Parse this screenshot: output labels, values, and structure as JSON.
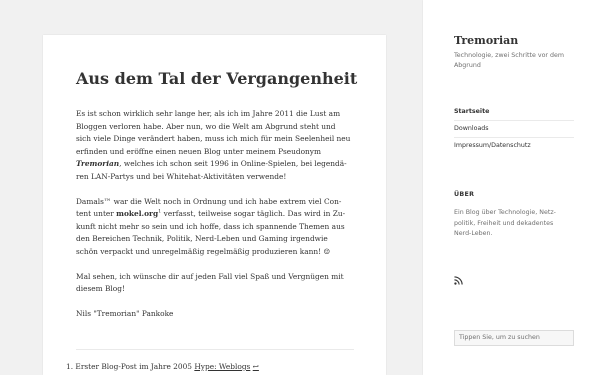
{
  "site": {
    "title": "Tremorian",
    "description": "Technologie, zwei Schritte vor dem Abgrund"
  },
  "nav": {
    "items": [
      {
        "label": "Startseite",
        "active": true
      },
      {
        "label": "Downloads",
        "active": false
      },
      {
        "label": "Impressum/Datenschutz",
        "active": false
      }
    ]
  },
  "widget": {
    "title": "ÜBER",
    "text": "Ein Blog über Technologie, Netz­politik, Freiheit und dekadentes Nerd-Leben."
  },
  "search": {
    "placeholder": "Tippen Sie, um zu suchen"
  },
  "icons": {
    "rss": "rss-icon",
    "backlink": "return-arrow-icon"
  },
  "post": {
    "title": "Aus dem Tal der Vergangenheit",
    "p1": [
      "Es ist schon wirklich sehr lange her, als ich im Jahre 2011 die Lust am",
      "Bloggen verloren habe. Aber nun, wo die Welt am Abgrund steht und",
      "sich viele Dinge verändert haben, muss ich mich für mein Seelenheil neu",
      "erfinden und eröffne einen neuen Blog unter meinem Pseudonym"
    ],
    "p1_name": "Tremorian",
    "p1_after_name": ", welches ich schon seit 1996 in Online-Spielen, bei legendä-",
    "p1_last": "ren LAN-Partys und bei Whitehat-Aktivitäten verwende!",
    "p2_start": "Damals™ war die Welt noch in Ordnung und ich habe extrem viel Con-",
    "p2_line2_before": "tent unter ",
    "p2_link": "mokel.org",
    "p2_sup": "1",
    "p2_line2_after": " verfasst, teilweise sogar täglich. Das wird in Zu-",
    "p2_rest": [
      "kunft nicht mehr so sein und ich hoffe, dass ich spannende Themen aus",
      "den Bereichen Technik, Politik, Nerd-Leben und Gaming irgendwie",
      "schön verpackt und unregelmäßig regelmäßig produzieren kann! ☺"
    ],
    "p3": [
      "Mal sehen, ich wünsche dir auf jeden Fall viel Spaß und Vergnügen mit",
      "diesem Blog!"
    ],
    "signature": "Nils \"Tremorian\" Pankoke"
  },
  "footnotes": {
    "items": [
      {
        "number": "1.",
        "text": "Erster Blog-Post im Jahre 2005 ",
        "link": "Hype: Weblogs",
        "back": "↩"
      }
    ]
  }
}
